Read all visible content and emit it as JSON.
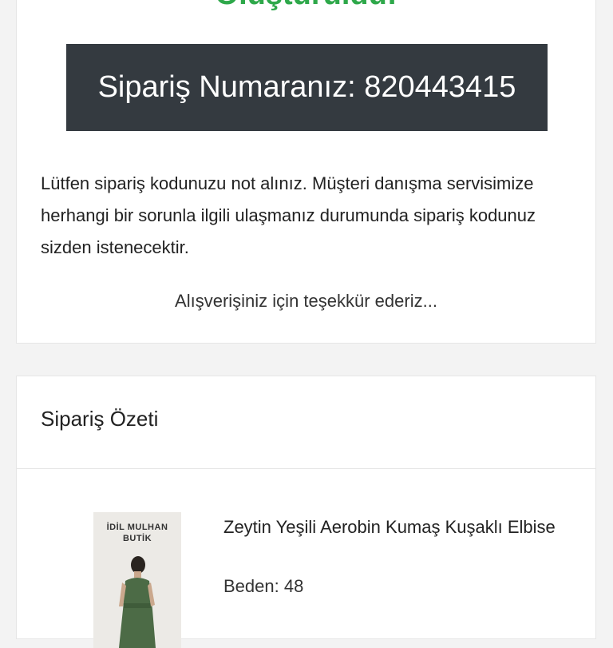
{
  "confirmation": {
    "title": "Oluşturuldu!",
    "order_label": "Sipariş Numaranız: 820443415",
    "notice": "Lütfen sipariş kodunuzu not alınız. Müşteri danışma servisimize herhangi bir sorunla ilgili ulaşmanız durumunda sipariş kodunuz sizden istenecektir.",
    "thanks": "Alışverişiniz için teşekkür ederiz...",
    "accent_color": "#2ea84a",
    "box_color": "#343a40"
  },
  "summary": {
    "title": "Sipariş Özeti",
    "items": [
      {
        "thumb_brand_line1": "İDİL MULHAN",
        "thumb_brand_line2": "BUTİK",
        "name": "Zeytin Yeşili Aerobin Kumaş Kuşaklı Elbise",
        "size_label": "Beden",
        "size_value": "48"
      }
    ]
  }
}
